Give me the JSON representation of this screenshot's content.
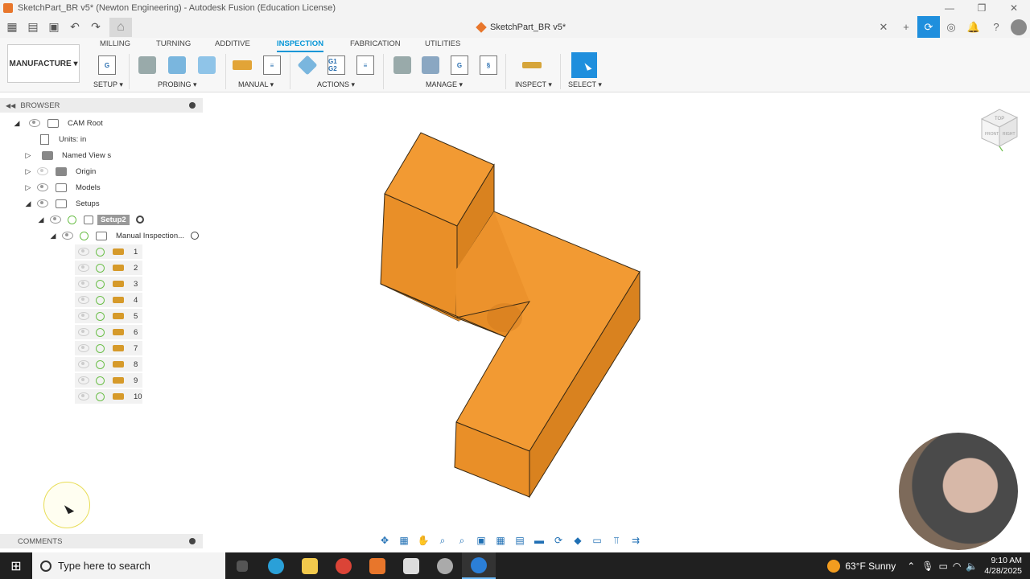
{
  "window": {
    "title": "SketchPart_BR v5* (Newton Engineering) - Autodesk Fusion (Education License)"
  },
  "document": {
    "tab_name": "SketchPart_BR v5*"
  },
  "workspace": {
    "label": "MANUFACTURE ▾"
  },
  "tabs": [
    {
      "label": "MILLING",
      "active": false
    },
    {
      "label": "TURNING",
      "active": false
    },
    {
      "label": "ADDITIVE",
      "active": false
    },
    {
      "label": "INSPECTION",
      "active": true
    },
    {
      "label": "FABRICATION",
      "active": false
    },
    {
      "label": "UTILITIES",
      "active": false
    }
  ],
  "groups": {
    "setup": "SETUP ▾",
    "probing": "PROBING ▾",
    "manual": "MANUAL ▾",
    "actions": "ACTIONS ▾",
    "manage": "MANAGE ▾",
    "inspect": "INSPECT ▾",
    "select": "SELECT ▾"
  },
  "tool_labels": {
    "g_code": "G",
    "g1g2": "G1 G2"
  },
  "browser": {
    "title": "BROWSER",
    "items": {
      "cam_root": "CAM Root",
      "units": "Units: in",
      "named_views": "Named View s",
      "origin": "Origin",
      "models": "Models",
      "setups": "Setups",
      "setup2": "Setup2",
      "manual_inspection": "Manual Inspection..."
    },
    "operations": [
      "1",
      "2",
      "3",
      "4",
      "5",
      "6",
      "7",
      "8",
      "9",
      "10"
    ]
  },
  "comments": {
    "title": "COMMENTS"
  },
  "viewcube": {
    "top": "TOP",
    "front": "FRONT",
    "right": "RIGHT"
  },
  "colors": {
    "accent": "#0696d7",
    "part": "#f29a33",
    "part_dark": "#d9821f",
    "part_side": "#e98f28"
  },
  "taskbar": {
    "search_placeholder": "Type here to search",
    "weather": "63°F  Sunny",
    "time": "9:10 AM",
    "date": "4/28/2025"
  }
}
